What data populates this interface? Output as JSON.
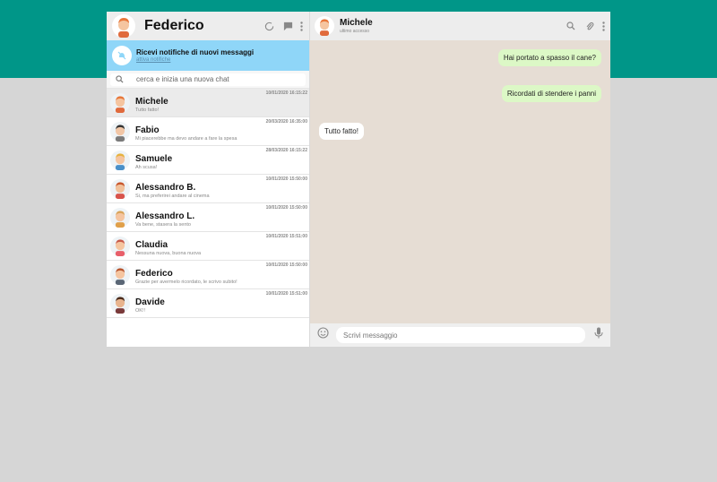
{
  "user": {
    "name": "Federico"
  },
  "notification": {
    "title": "Ricevi notifiche di nuovi messaggi",
    "link": "attiva notifiche"
  },
  "search": {
    "placeholder": "cerca e inizia una nuova chat"
  },
  "chats": [
    {
      "name": "Michele",
      "last": "Tutto fatto!",
      "time": "10/01/2020 16:15:22",
      "active": true,
      "hair": "#e8773a",
      "skin": "#f5c5a0",
      "shirt": "#e06a3c"
    },
    {
      "name": "Fabio",
      "last": "Mi piacerebbe ma devo andare a fare la spesa",
      "time": "20/03/2020 16:35:00",
      "hair": "#333333",
      "skin": "#f1c6a6",
      "shirt": "#7a7a7a"
    },
    {
      "name": "Samuele",
      "last": "Ah scusa!",
      "time": "28/03/2020 16:15:22",
      "hair": "#e6b23e",
      "skin": "#f5c5a0",
      "shirt": "#4a90c9"
    },
    {
      "name": "Alessandro B.",
      "last": "Si, ma preferirei andare al cinema",
      "time": "10/01/2020 15:50:00",
      "hair": "#c8572c",
      "skin": "#f1c19b",
      "shirt": "#d8544c"
    },
    {
      "name": "Alessandro L.",
      "last": "Va bene, stasera la sento",
      "time": "10/01/2020 15:50:00",
      "hair": "#d9a45a",
      "skin": "#f5c5a0",
      "shirt": "#e0a04a"
    },
    {
      "name": "Claudia",
      "last": "Nessuna nuova, buona nuova",
      "time": "10/01/2020 15:51:00",
      "hair": "#c85a4a",
      "skin": "#f5c5a0",
      "shirt": "#e85f6a"
    },
    {
      "name": "Federico",
      "last": "Grazie per avermelo ricordato, le scrivo subito!",
      "time": "10/01/2020 15:50:00",
      "hair": "#b8552e",
      "skin": "#f5c5a0",
      "shirt": "#5a6675"
    },
    {
      "name": "Davide",
      "last": "OK!!",
      "time": "10/01/2020 15:51:00",
      "hair": "#4a2a1a",
      "skin": "#e8b48e",
      "shirt": "#7a3a3a"
    }
  ],
  "conversation": {
    "contact": "Michele",
    "status": "ultimo accesso",
    "messages": [
      {
        "text": "Hai portato a spasso il cane?",
        "type": "sent"
      },
      {
        "text": "Ricordati di stendere i panni",
        "type": "sent"
      },
      {
        "text": "Tutto fatto!",
        "type": "recv"
      }
    ]
  },
  "compose": {
    "placeholder": "Scrivi messaggio"
  },
  "colors": {
    "teal": "#009688",
    "sent_bubble": "#dcf8c6",
    "notif_bg": "#8fd6f8"
  },
  "icons": [
    "status-icon",
    "chat-icon",
    "menu-icon",
    "bell-off-icon",
    "search-icon",
    "paperclip-icon",
    "emoji-icon",
    "mic-icon"
  ]
}
